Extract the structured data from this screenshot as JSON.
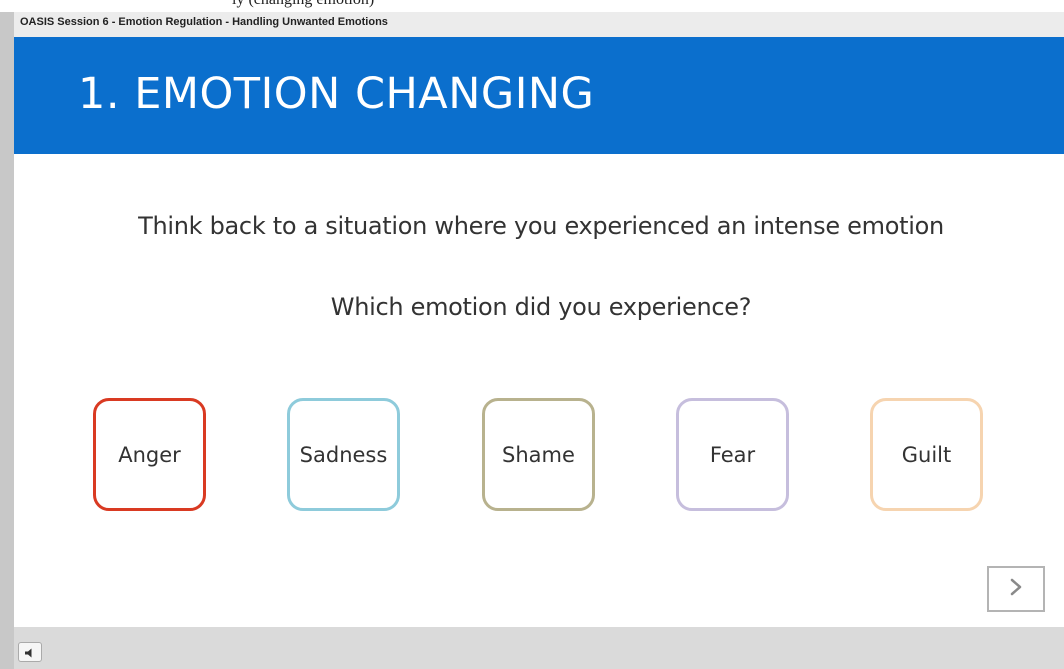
{
  "page_top_fragment": "ly (changing emotion)",
  "session": {
    "title": "OASIS Session 6 - Emotion Regulation - Handling Unwanted Emotions"
  },
  "slide": {
    "title": "1. EMOTION CHANGING",
    "header_color": "#0b6fcd",
    "prompt_1": "Think back to a situation where you experienced an intense emotion",
    "prompt_2": "Which emotion did you experience?"
  },
  "options": [
    {
      "label": "Anger",
      "border_color": "#d93a22"
    },
    {
      "label": "Sadness",
      "border_color": "#8ecbdb"
    },
    {
      "label": "Shame",
      "border_color": "#b8b28e"
    },
    {
      "label": "Fear",
      "border_color": "#c6bedd"
    },
    {
      "label": "Guilt",
      "border_color": "#f6d4b0"
    }
  ],
  "navigation": {
    "next_icon": "chevron-right-icon"
  },
  "player_controls": {
    "audio_icon": "speaker-icon"
  }
}
